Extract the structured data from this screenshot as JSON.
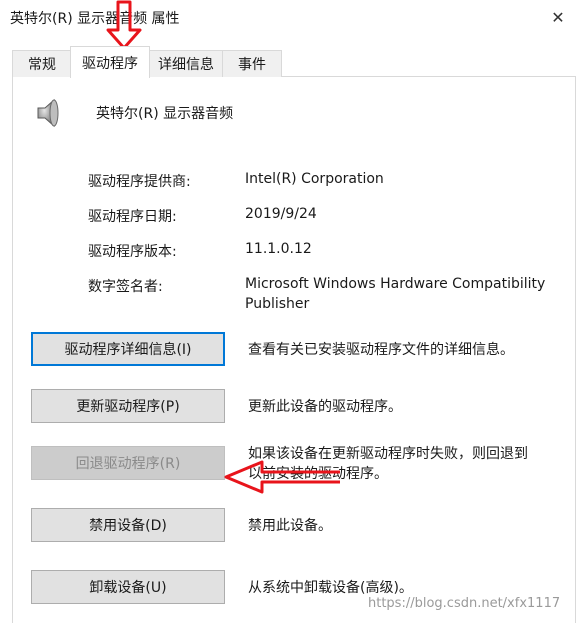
{
  "window": {
    "title": "英特尔(R) 显示器音频 属性",
    "close_glyph": "✕"
  },
  "tabs": [
    {
      "label": "常规",
      "active": false
    },
    {
      "label": "驱动程序",
      "active": true
    },
    {
      "label": "详细信息",
      "active": false
    },
    {
      "label": "事件",
      "active": false
    }
  ],
  "device": {
    "name": "英特尔(R) 显示器音频",
    "icon": "speaker-icon"
  },
  "info": [
    {
      "label": "驱动程序提供商:",
      "value": "Intel(R) Corporation"
    },
    {
      "label": "驱动程序日期:",
      "value": "2019/9/24"
    },
    {
      "label": "驱动程序版本:",
      "value": "11.1.0.12"
    },
    {
      "label": "数字签名者:",
      "value_line1": "Microsoft Windows Hardware Compatibility",
      "value_line2": "Publisher"
    }
  ],
  "actions": [
    {
      "button": "驱动程序详细信息(I)",
      "description": "查看有关已安装驱动程序文件的详细信息。",
      "state": "focused"
    },
    {
      "button": "更新驱动程序(P)",
      "description": "更新此设备的驱动程序。",
      "state": "normal"
    },
    {
      "button": "回退驱动程序(R)",
      "description_line1": "如果该设备在更新驱动程序时失败，则回退到",
      "description_line2": "以前安装的驱动程序。",
      "state": "disabled"
    },
    {
      "button": "禁用设备(D)",
      "description": "禁用此设备。",
      "state": "normal"
    },
    {
      "button": "卸载设备(U)",
      "description": "从系统中卸载设备(高级)。",
      "state": "normal"
    }
  ],
  "watermark": "https://blog.csdn.net/xfx1117",
  "colors": {
    "annotation_arrow": "#e8141b",
    "focus_border": "#0078d7"
  }
}
